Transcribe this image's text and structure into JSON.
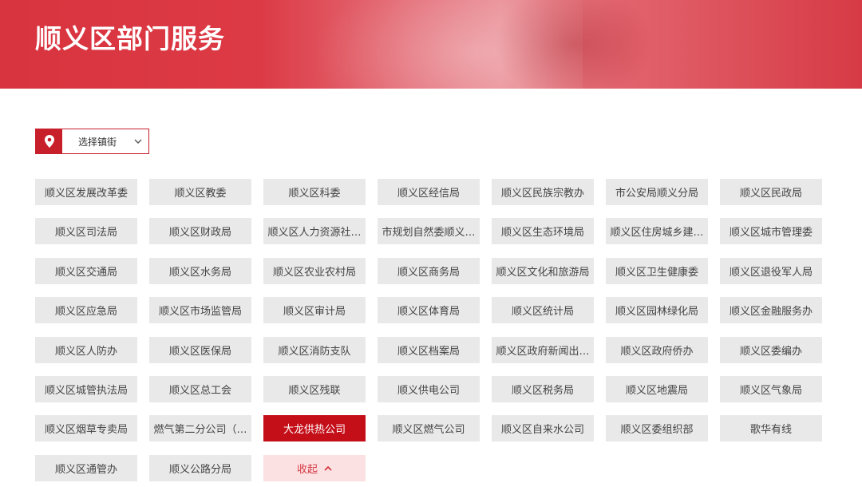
{
  "header": {
    "title": "顺义区部门服务"
  },
  "town_select": {
    "label": "选择镇街",
    "icon": "location-pin-icon"
  },
  "accent_color": "#c40f19",
  "departments": [
    "顺义区发展改革委",
    "顺义区教委",
    "顺义区科委",
    "顺义区经信局",
    "顺义区民族宗教办",
    "市公安局顺义分局",
    "顺义区民政局",
    "顺义区司法局",
    "顺义区财政局",
    "顺义区人力资源社…",
    "市规划自然委顺义…",
    "顺义区生态环境局",
    "顺义区住房城乡建…",
    "顺义区城市管理委",
    "顺义区交通局",
    "顺义区水务局",
    "顺义区农业农村局",
    "顺义区商务局",
    "顺义区文化和旅游局",
    "顺义区卫生健康委",
    "顺义区退役军人局",
    "顺义区应急局",
    "顺义区市场监管局",
    "顺义区审计局",
    "顺义区体育局",
    "顺义区统计局",
    "顺义区园林绿化局",
    "顺义区金融服务办",
    "顺义区人防办",
    "顺义区医保局",
    "顺义区消防支队",
    "顺义区档案局",
    "顺义区政府新闻出…",
    "顺义区政府侨办",
    "顺义区委编办",
    "顺义区城管执法局",
    "顺义区总工会",
    "顺义区残联",
    "顺义供电公司",
    "顺义区税务局",
    "顺义区地震局",
    "顺义区气象局",
    "顺义区烟草专卖局",
    "燃气第二分公司（…",
    "大龙供热公司",
    "顺义区燃气公司",
    "顺义区自来水公司",
    "顺义区委组织部",
    "歌华有线",
    "顺义区通管办",
    "顺义公路分局"
  ],
  "active_department": "大龙供热公司",
  "collapse_button": {
    "label": "收起",
    "icon": "chevron-up-icon"
  }
}
